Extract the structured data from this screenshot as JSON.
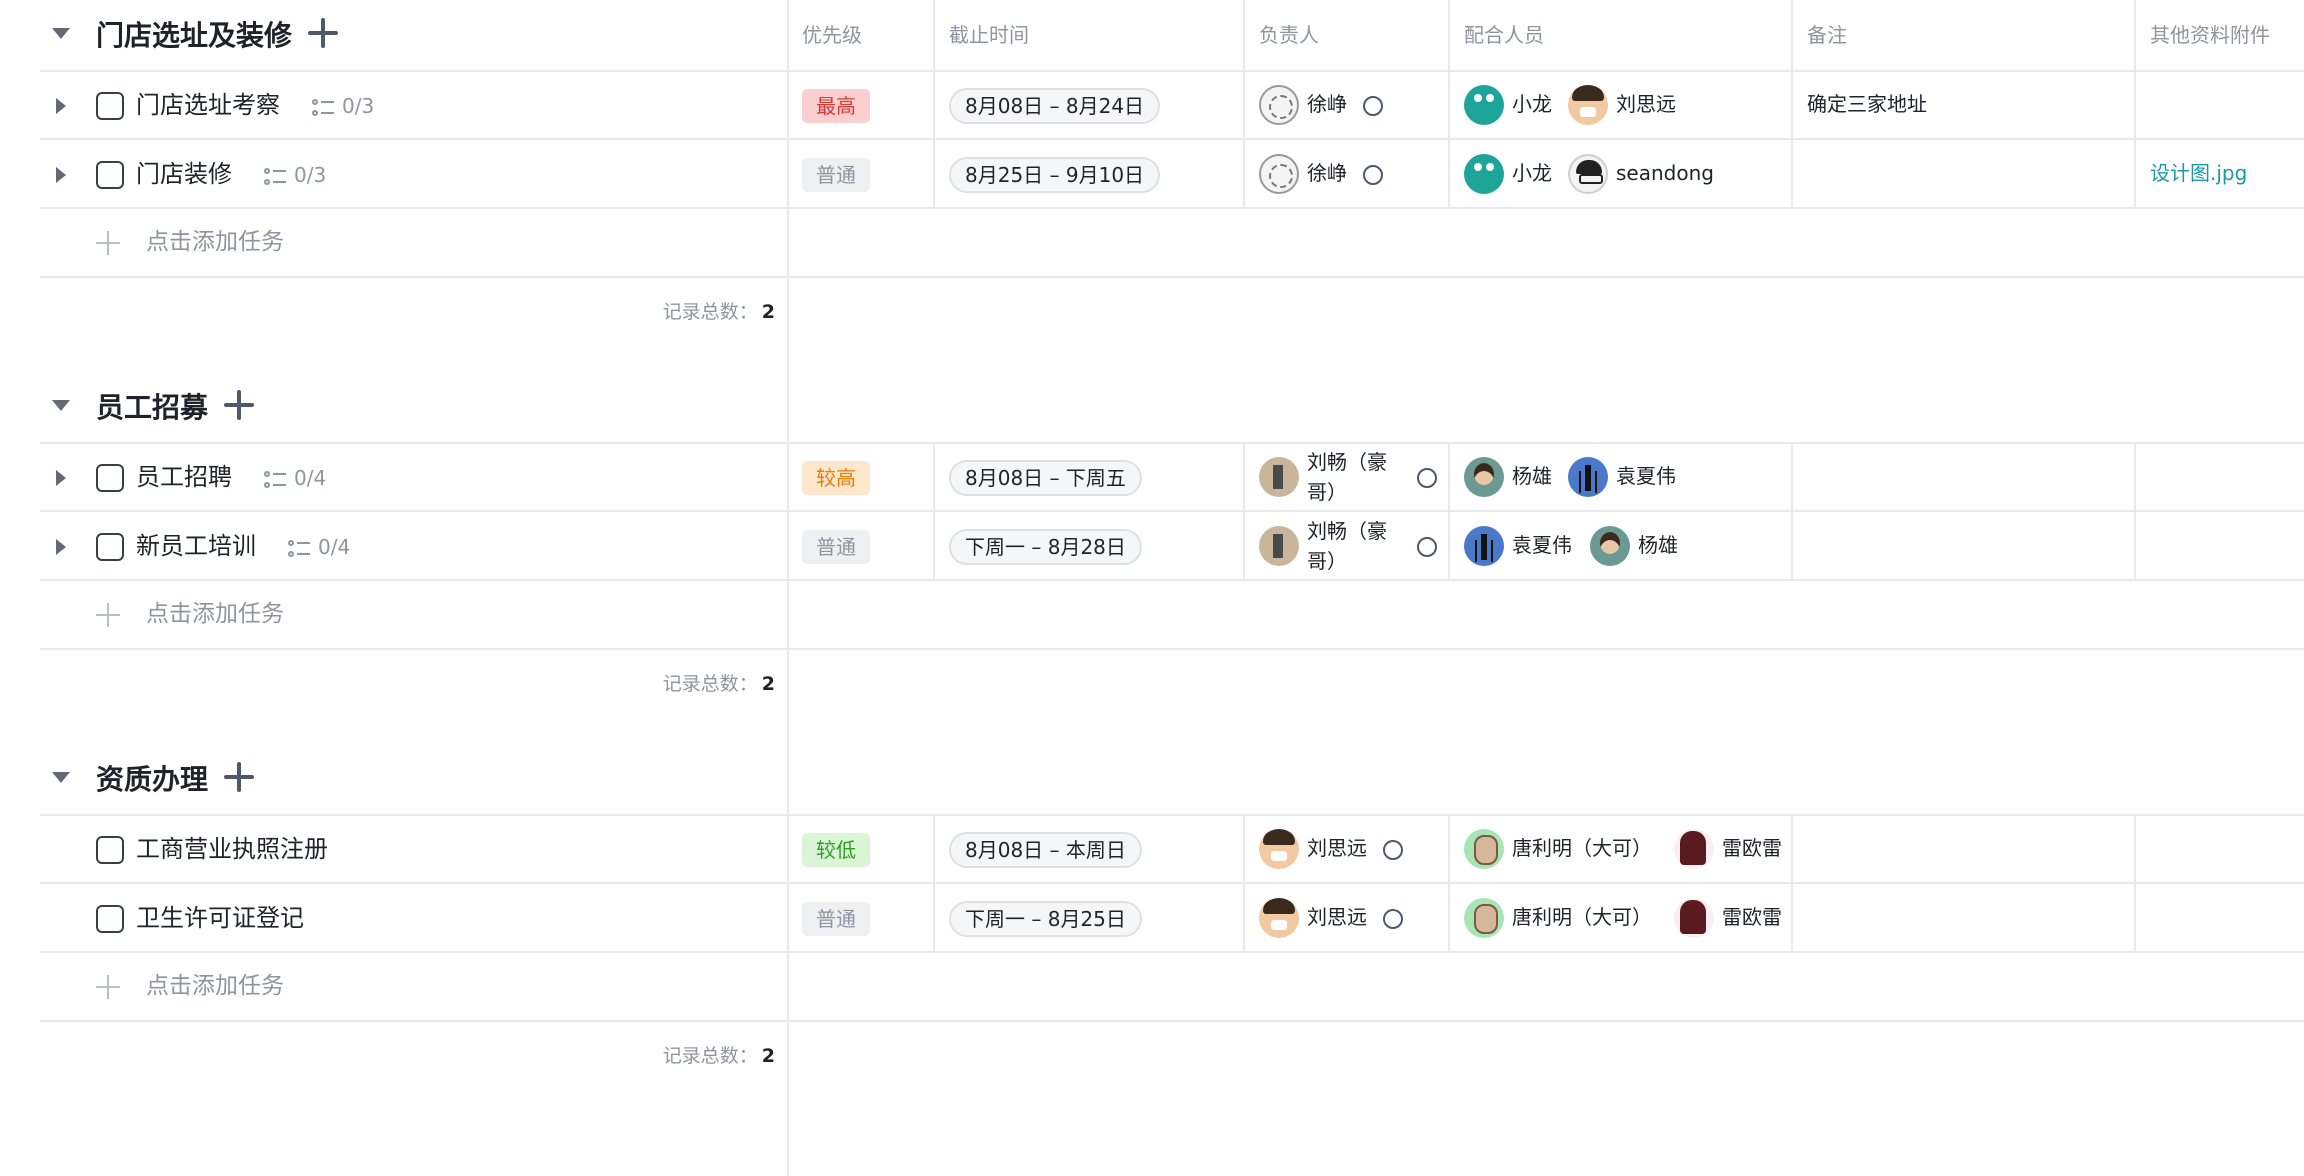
{
  "columns": {
    "priority": "优先级",
    "deadline": "截止时间",
    "owner": "负责人",
    "collaborators": "配合人员",
    "notes": "备注",
    "attachments": "其他资料附件"
  },
  "add_task_label": "点击添加任务",
  "record_count_label": "记录总数：",
  "groups": [
    {
      "title": "门店选址及装修",
      "count": "2",
      "tasks": [
        {
          "title": "门店选址考察",
          "subtasks": "0/3",
          "priority": "最高",
          "date": "8月08日 – 8月24日",
          "owner": "徐峥",
          "collab1": "小龙",
          "collab2": "刘思远",
          "note": "确定三家地址",
          "attachment": ""
        },
        {
          "title": "门店装修",
          "subtasks": "0/3",
          "priority": "普通",
          "date": "8月25日 – 9月10日",
          "owner": "徐峥",
          "collab1": "小龙",
          "collab2": "seandong",
          "note": "",
          "attachment": "设计图.jpg"
        }
      ]
    },
    {
      "title": "员工招募",
      "count": "2",
      "tasks": [
        {
          "title": "员工招聘",
          "subtasks": "0/4",
          "priority": "较高",
          "date": "8月08日 – 下周五",
          "owner": "刘畅（豪哥）",
          "collab1": "杨雄",
          "collab2": "袁夏伟",
          "note": "",
          "attachment": ""
        },
        {
          "title": "新员工培训",
          "subtasks": "0/4",
          "priority": "普通",
          "date": "下周一 – 8月28日",
          "owner": "刘畅（豪哥）",
          "collab1": "袁夏伟",
          "collab2": "杨雄",
          "note": "",
          "attachment": ""
        }
      ]
    },
    {
      "title": "资质办理",
      "count": "2",
      "tasks": [
        {
          "title": "工商营业执照注册",
          "subtasks": "",
          "priority": "较低",
          "date": "8月08日 – 本周日",
          "owner": "刘思远",
          "collab1": "唐利明（大可）",
          "collab2": "雷欧雷欧",
          "note": "",
          "attachment": ""
        },
        {
          "title": "卫生许可证登记",
          "subtasks": "",
          "priority": "普通",
          "date": "下周一 – 8月25日",
          "owner": "刘思远",
          "collab1": "唐利明（大可）",
          "collab2": "雷欧雷欧",
          "note": "",
          "attachment": ""
        }
      ]
    }
  ]
}
